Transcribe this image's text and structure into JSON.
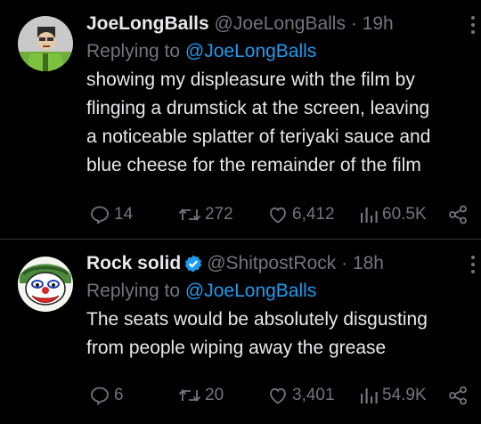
{
  "tweets": [
    {
      "display_name": "JoeLongBalls",
      "handle": "@JoeLongBalls",
      "dot": "·",
      "time": "19h",
      "replying_prefix": "Replying to",
      "replying_to": "@JoeLongBalls",
      "body_lines": [
        "showing my displeasure with the film by",
        "flinging a drumstick at the screen, leaving",
        "a noticeable splatter of teriyaki sauce and",
        "blue cheese for the remainder of the film"
      ],
      "verified": false,
      "avatar_icon": "cartoon-man-avatar",
      "stats": {
        "replies": "14",
        "reposts": "272",
        "likes": "6,412",
        "views": "60.5K"
      }
    },
    {
      "display_name": "Rock solid",
      "handle": "@ShitpostRock",
      "dot": "·",
      "time": "18h",
      "replying_prefix": "Replying to",
      "replying_to": "@JoeLongBalls",
      "body_lines": [
        "The seats would be absolutely disgusting",
        "from people wiping away the grease"
      ],
      "verified": true,
      "avatar_icon": "cartoon-clown-avatar",
      "stats": {
        "replies": "6",
        "reposts": "20",
        "likes": "3,401",
        "views": "54.9K"
      }
    }
  ],
  "colors": {
    "background": "#000000",
    "text": "#e7e9ea",
    "muted": "#71767b",
    "link": "#1d9bf0",
    "divider": "#2f3336",
    "verified": "#1d9bf0"
  }
}
